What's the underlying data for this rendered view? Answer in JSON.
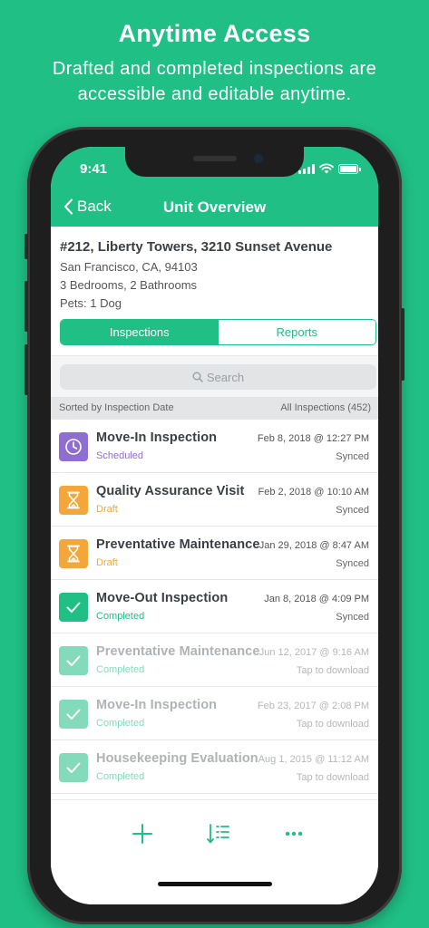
{
  "promo": {
    "title": "Anytime Access",
    "subtitle": "Drafted and completed inspections are accessible and editable anytime."
  },
  "status_bar": {
    "time": "9:41"
  },
  "nav": {
    "back_label": "Back",
    "title": "Unit Overview"
  },
  "unit": {
    "address": "#212, Liberty Towers, 3210 Sunset Avenue",
    "city": "San Francisco, CA, 94103",
    "rooms": "3 Bedrooms, 2 Bathrooms",
    "pets": "Pets: 1 Dog"
  },
  "segments": {
    "inspections": "Inspections",
    "reports": "Reports"
  },
  "search": {
    "placeholder": "Search"
  },
  "sort": {
    "left": "Sorted by Inspection Date",
    "right": "All Inspections (452)"
  },
  "colors": {
    "brand": "#1fbf85",
    "scheduled": "#8e6fd1",
    "draft": "#f3a73b",
    "completed": "#1fbf85"
  },
  "inspections": [
    {
      "title": "Move-In Inspection",
      "status": "Scheduled",
      "date": "Feb 8, 2018 @ 12:27 PM",
      "sync": "Synced",
      "icon": "clock-icon",
      "kind": "scheduled"
    },
    {
      "title": "Quality Assurance Visit",
      "status": "Draft",
      "date": "Feb 2, 2018 @ 10:10 AM",
      "sync": "Synced",
      "icon": "hourglass-icon",
      "kind": "draft"
    },
    {
      "title": "Preventative Maintenance",
      "status": "Draft",
      "date": "Jan 29, 2018 @ 8:47 AM",
      "sync": "Synced",
      "icon": "hourglass-icon",
      "kind": "draft"
    },
    {
      "title": "Move-Out Inspection",
      "status": "Completed",
      "date": "Jan 8, 2018 @ 4:09 PM",
      "sync": "Synced",
      "icon": "checkmark-icon",
      "kind": "completed"
    },
    {
      "title": "Preventative Maintenance",
      "status": "Completed",
      "date": "Jun 12, 2017 @ 9:16 AM",
      "sync": "Tap to download",
      "icon": "checkmark-icon",
      "kind": "completed",
      "faded": true
    },
    {
      "title": "Move-In Inspection",
      "status": "Completed",
      "date": "Feb 23, 2017 @ 2:08 PM",
      "sync": "Tap to download",
      "icon": "checkmark-icon",
      "kind": "completed",
      "faded": true
    },
    {
      "title": "Housekeeping Evaluation",
      "status": "Completed",
      "date": "Aug 1, 2015 @ 11:12 AM",
      "sync": "Tap to download",
      "icon": "checkmark-icon",
      "kind": "completed",
      "faded": true
    }
  ],
  "toolbar": {
    "add_icon": "plus-icon",
    "sort_icon": "sort-list-icon",
    "more_icon": "more-icon"
  }
}
